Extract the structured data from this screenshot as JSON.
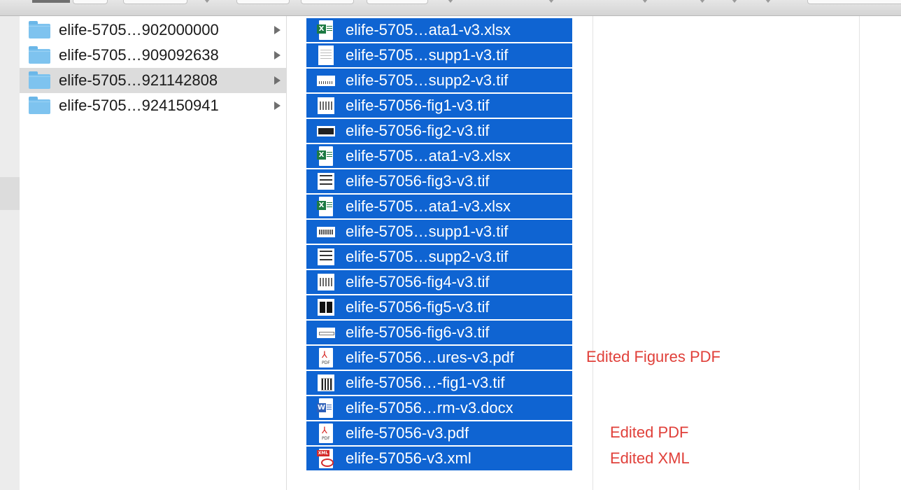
{
  "colors": {
    "selection": "#0f64d2",
    "folder": "#7ec3ef",
    "annotation": "#e0403a",
    "excel": "#1d7a43",
    "word": "#2d5fb8",
    "pdf": "#d6231f"
  },
  "folders": [
    {
      "label": "elife-5705…902000000",
      "icon": "folder-icon",
      "selected": false
    },
    {
      "label": "elife-5705…909092638",
      "icon": "folder-icon",
      "selected": false
    },
    {
      "label": "elife-5705…921142808",
      "icon": "folder-icon",
      "selected": true
    },
    {
      "label": "elife-5705…924150941",
      "icon": "folder-icon",
      "selected": false
    }
  ],
  "files": [
    {
      "label": "elife-5705…ata1-v3.xlsx",
      "icon": "excel-file-icon"
    },
    {
      "label": "elife-5705…supp1-v3.tif",
      "icon": "tif-thumbnail-icon"
    },
    {
      "label": "elife-5705…supp2-v3.tif",
      "icon": "tif-thumbnail-icon"
    },
    {
      "label": "elife-57056-fig1-v3.tif",
      "icon": "tif-thumbnail-icon"
    },
    {
      "label": "elife-57056-fig2-v3.tif",
      "icon": "tif-thumbnail-icon"
    },
    {
      "label": "elife-5705…ata1-v3.xlsx",
      "icon": "excel-file-icon"
    },
    {
      "label": "elife-57056-fig3-v3.tif",
      "icon": "tif-thumbnail-icon"
    },
    {
      "label": "elife-5705…ata1-v3.xlsx",
      "icon": "excel-file-icon"
    },
    {
      "label": "elife-5705…supp1-v3.tif",
      "icon": "tif-thumbnail-icon"
    },
    {
      "label": "elife-5705…supp2-v3.tif",
      "icon": "tif-thumbnail-icon"
    },
    {
      "label": "elife-57056-fig4-v3.tif",
      "icon": "tif-thumbnail-icon"
    },
    {
      "label": "elife-57056-fig5-v3.tif",
      "icon": "tif-thumbnail-icon"
    },
    {
      "label": "elife-57056-fig6-v3.tif",
      "icon": "tif-thumbnail-icon"
    },
    {
      "label": "elife-57056…ures-v3.pdf",
      "icon": "pdf-file-icon"
    },
    {
      "label": "elife-57056…-fig1-v3.tif",
      "icon": "tif-thumbnail-icon"
    },
    {
      "label": "elife-57056…rm-v3.docx",
      "icon": "word-file-icon"
    },
    {
      "label": "elife-57056-v3.pdf",
      "icon": "pdf-file-icon"
    },
    {
      "label": "elife-57056-v3.xml",
      "icon": "xml-file-icon"
    }
  ],
  "icon_glyphs": {
    "excel": "X",
    "word": "W",
    "pdf_symbol": "⅄",
    "pdf_text": "PDF",
    "xml_text": "XML"
  },
  "annotations": {
    "figures_pdf": "Edited Figures PDF",
    "pdf": "Edited PDF",
    "xml": "Edited XML"
  }
}
